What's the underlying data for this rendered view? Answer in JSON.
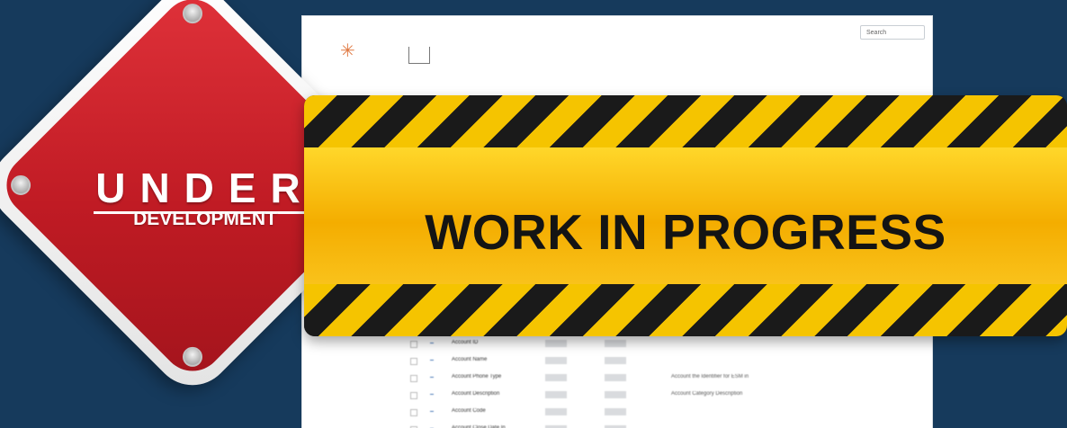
{
  "sign": {
    "line1": "UNDER",
    "line2": "DEVELOPMENT",
    "color": "#c01b24"
  },
  "banner": {
    "text": "WORK IN PROGRESS",
    "stripe_colors": [
      "#f5c400",
      "#1a1a1a"
    ]
  },
  "background_screenshot": {
    "search_placeholder": "Search",
    "rows": [
      {
        "name": "Account ID"
      },
      {
        "name": "Account Name"
      },
      {
        "name": "Account Phone Type",
        "desc": "Account the Identifier for ESM in"
      },
      {
        "name": "Account Description",
        "desc": "Account Category Description"
      },
      {
        "name": "Account Code"
      },
      {
        "name": "Account Close Date In"
      }
    ]
  },
  "colors": {
    "background": "#163a5c",
    "banner_yellow": "#ffd72a"
  }
}
